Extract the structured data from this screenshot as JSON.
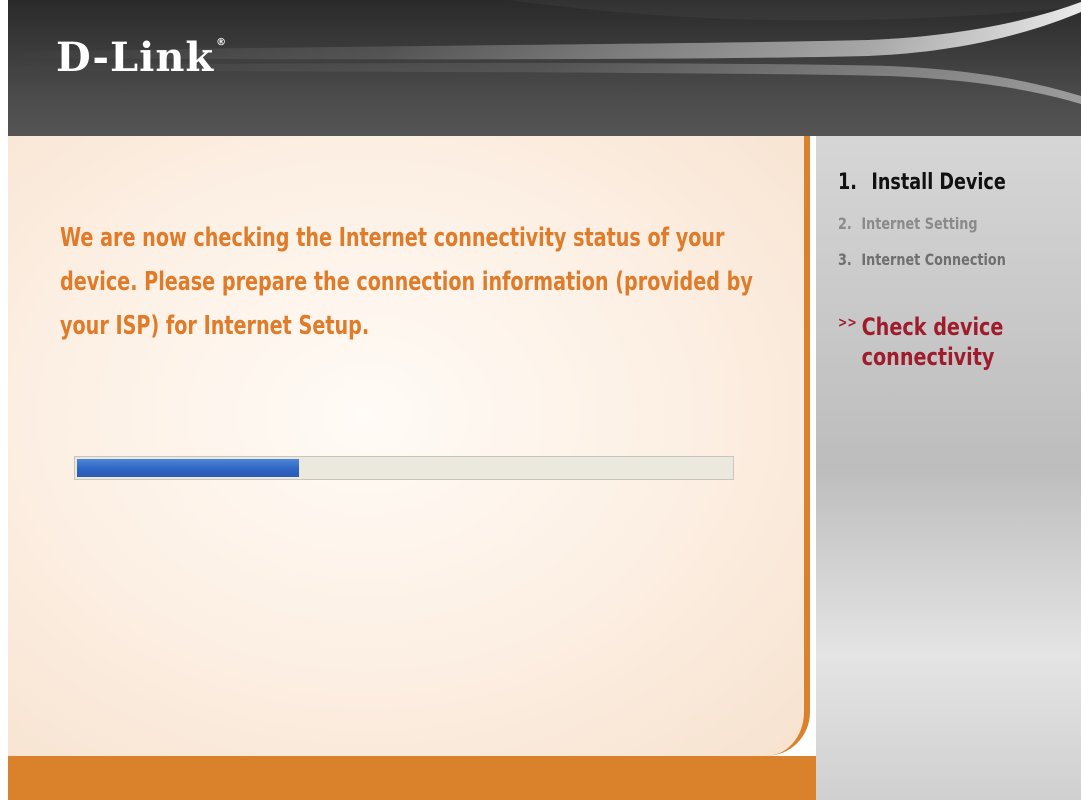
{
  "header": {
    "logo_text": "D-Link",
    "logo_mark": "®"
  },
  "main": {
    "message": "We are now checking the Internet connectivity status of your device. Please prepare the connection information (provided by your ISP)  for Internet Setup.",
    "progress": {
      "fraction": 0.34
    }
  },
  "sidebar": {
    "steps": [
      {
        "number": "1.",
        "label": "Install Device",
        "state": "active"
      },
      {
        "number": "2.",
        "label": "Internet Setting",
        "state": "inactive"
      },
      {
        "number": "3.",
        "label": "Internet Connection",
        "state": "inactive"
      }
    ],
    "current_substep": {
      "marker": ">>",
      "line1": "Check device",
      "line2": "connectivity"
    }
  },
  "colors": {
    "accent_orange": "#d9822b",
    "message_orange": "#e07b2a",
    "progress_blue": "#2f65c4",
    "substep_red": "#9e1c2c"
  }
}
